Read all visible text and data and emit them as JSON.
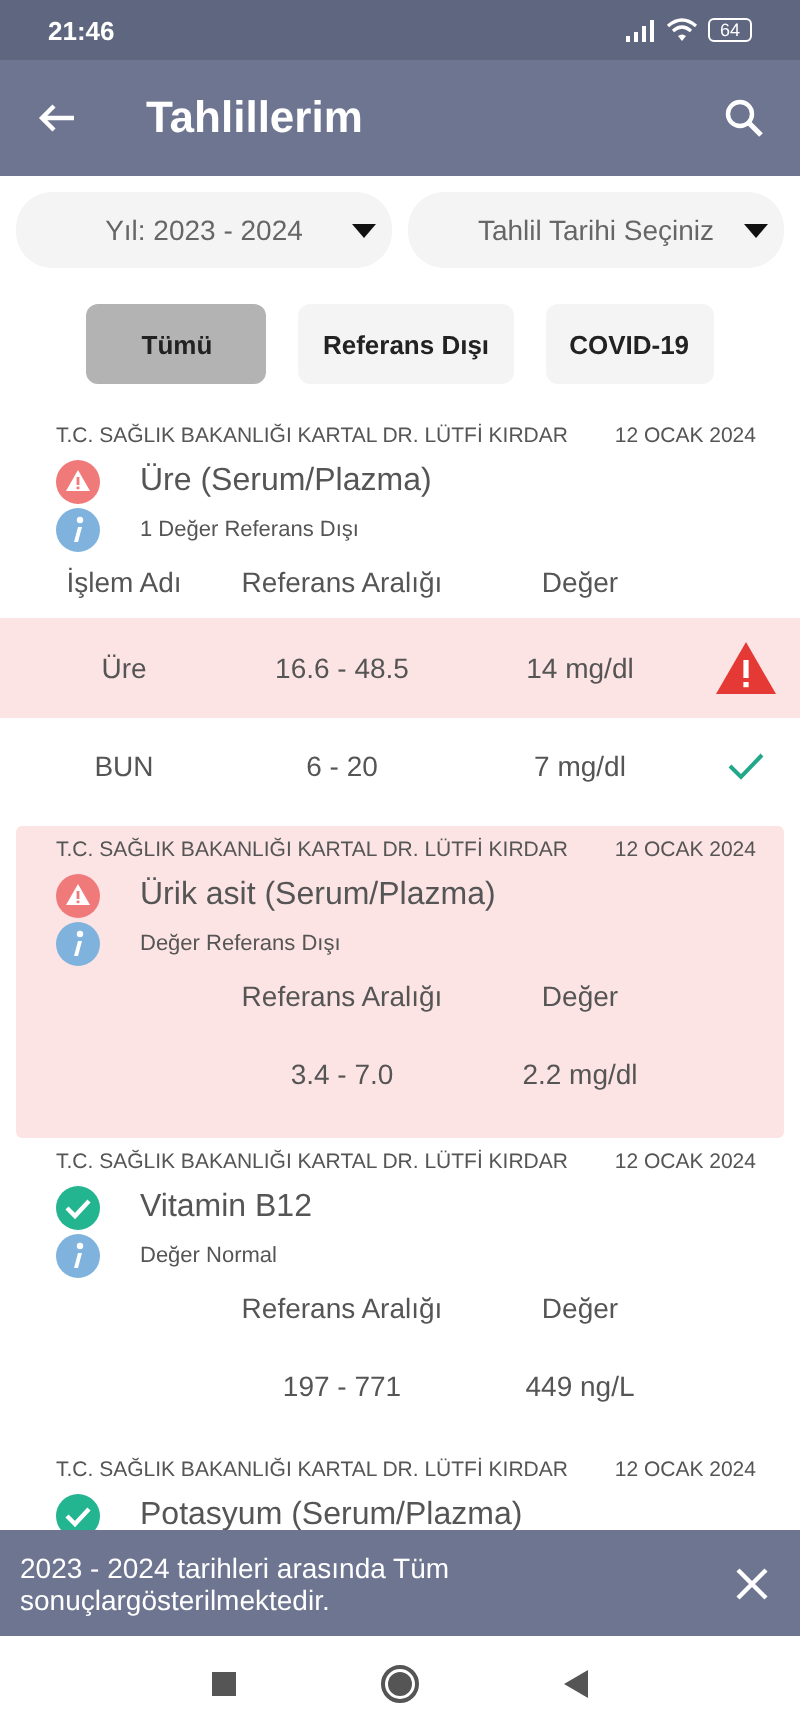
{
  "status_bar": {
    "time": "21:46",
    "battery": "64"
  },
  "app_bar": {
    "title": "Tahlillerim"
  },
  "dropdowns": [
    {
      "value": "Yıl: 2023 - 2024"
    },
    {
      "value": "Tahlil Tarihi Seçiniz"
    }
  ],
  "filters": [
    {
      "label": "Tümü",
      "selected": true
    },
    {
      "label": "Referans Dışı",
      "selected": false
    },
    {
      "label": "COVID-19",
      "selected": false
    }
  ],
  "results": [
    {
      "kind": "multi",
      "hospital": "T.C. SAĞLIK BAKANLIĞI KARTAL DR. LÜTFİ KIRDAR",
      "date": "12 OCAK 2024",
      "title": "Üre (Serum/Plazma)",
      "out_of_range": true,
      "note": "1 Değer Referans Dışı",
      "columns": [
        "İşlem Adı",
        "Referans Aralığı",
        "Değer"
      ],
      "rows": [
        {
          "name": "Üre",
          "range": "16.6 - 48.5",
          "value": "14 mg/dl",
          "out_of_range": true
        },
        {
          "name": "BUN",
          "range": "6 - 20",
          "value": "7 mg/dl",
          "out_of_range": false
        }
      ]
    },
    {
      "kind": "single",
      "hospital": "T.C. SAĞLIK BAKANLIĞI KARTAL DR. LÜTFİ KIRDAR",
      "date": "12 OCAK 2024",
      "title": "Ürik asit (Serum/Plazma)",
      "out_of_range": true,
      "note": "Değer Referans Dışı",
      "columns": [
        "Referans Aralığı",
        "Değer"
      ],
      "range": "3.4 - 7.0",
      "value": "2.2 mg/dl"
    },
    {
      "kind": "single",
      "hospital": "T.C. SAĞLIK BAKANLIĞI KARTAL DR. LÜTFİ KIRDAR",
      "date": "12 OCAK 2024",
      "title": "Vitamin B12",
      "out_of_range": false,
      "note": "Değer Normal",
      "columns": [
        "Referans Aralığı",
        "Değer"
      ],
      "range": "197 - 771",
      "value": "449 ng/L"
    },
    {
      "kind": "partial",
      "hospital": "T.C. SAĞLIK BAKANLIĞI KARTAL DR. LÜTFİ KIRDAR",
      "date": "12 OCAK 2024",
      "title": "Potasyum (Serum/Plazma)",
      "out_of_range": false
    }
  ],
  "snackbar": {
    "message": "2023 - 2024 tarihleri arasında Tüm sonuçlargösterilmektedir."
  }
}
